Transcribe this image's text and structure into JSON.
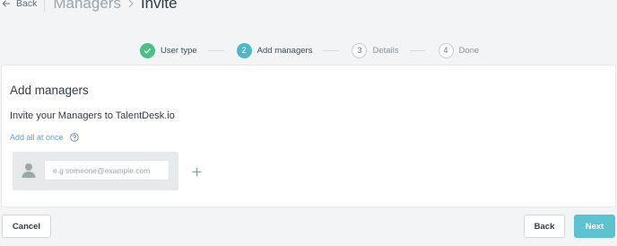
{
  "header": {
    "back_label": "Back",
    "breadcrumb_root": "Managers",
    "breadcrumb_current": "Invite"
  },
  "stepper": {
    "steps": [
      {
        "number": "",
        "label": "User type",
        "state": "done"
      },
      {
        "number": "2",
        "label": "Add managers",
        "state": "active"
      },
      {
        "number": "3",
        "label": "Details",
        "state": "todo"
      },
      {
        "number": "4",
        "label": "Done",
        "state": "todo"
      }
    ]
  },
  "main": {
    "title": "Add managers",
    "subtitle": "Invite your Managers to TalentDesk.io",
    "add_all_label": "Add all at once",
    "email_input": {
      "value": "",
      "placeholder": "e.g someone@example.com"
    }
  },
  "footer": {
    "cancel_label": "Cancel",
    "back_label": "Back",
    "next_label": "Next"
  },
  "colors": {
    "accent": "#4fb6c7",
    "success": "#4cbf85",
    "primary_button": "#5cc2cf"
  },
  "icons": {
    "back": "arrow-left-icon",
    "breadcrumb_separator": "chevron-right-icon",
    "step_done": "check-icon",
    "help": "question-circle-icon",
    "avatar": "user-silhouette-icon",
    "add": "plus-icon"
  }
}
